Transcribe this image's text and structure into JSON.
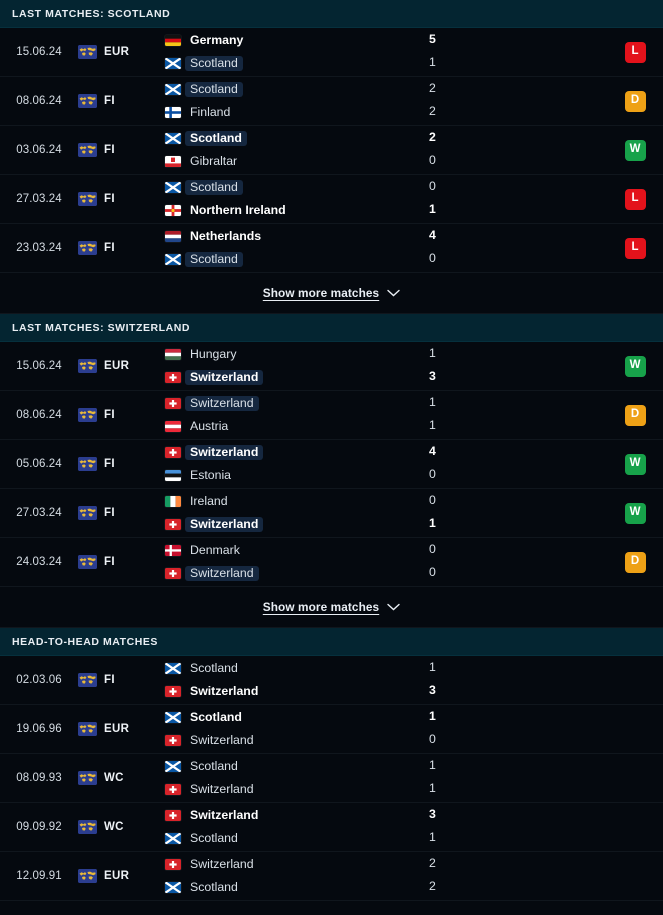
{
  "colors": {
    "background": "#05090f",
    "section_header_bg": "#042531",
    "highlight": "#15273f",
    "win_badge": "#17a24a",
    "draw_badge": "#eea116",
    "loss_badge": "#e3121b"
  },
  "sections": [
    {
      "id": "last-matches-scotland",
      "title": "LAST MATCHES: SCOTLAND",
      "show_more": {
        "label": "Show more matches",
        "icon": "chevron-down-icon"
      },
      "rows": [
        {
          "date": "15.06.24",
          "competition": "EUR",
          "competition_icon": "world-map-icon",
          "home": {
            "team": "Germany",
            "flag": "germany",
            "score": "5",
            "winner": true,
            "highlight": false
          },
          "away": {
            "team": "Scotland",
            "flag": "scotland",
            "score": "1",
            "winner": false,
            "highlight": true
          },
          "result": "L"
        },
        {
          "date": "08.06.24",
          "competition": "FI",
          "competition_icon": "world-map-icon",
          "home": {
            "team": "Scotland",
            "flag": "scotland",
            "score": "2",
            "winner": false,
            "highlight": true
          },
          "away": {
            "team": "Finland",
            "flag": "finland",
            "score": "2",
            "winner": false,
            "highlight": false
          },
          "result": "D"
        },
        {
          "date": "03.06.24",
          "competition": "FI",
          "competition_icon": "world-map-icon",
          "home": {
            "team": "Scotland",
            "flag": "scotland",
            "score": "2",
            "winner": true,
            "highlight": true
          },
          "away": {
            "team": "Gibraltar",
            "flag": "gibraltar",
            "score": "0",
            "winner": false,
            "highlight": false
          },
          "result": "W"
        },
        {
          "date": "27.03.24",
          "competition": "FI",
          "competition_icon": "world-map-icon",
          "home": {
            "team": "Scotland",
            "flag": "scotland",
            "score": "0",
            "winner": false,
            "highlight": true
          },
          "away": {
            "team": "Northern Ireland",
            "flag": "northern-ireland",
            "score": "1",
            "winner": true,
            "highlight": false
          },
          "result": "L"
        },
        {
          "date": "23.03.24",
          "competition": "FI",
          "competition_icon": "world-map-icon",
          "home": {
            "team": "Netherlands",
            "flag": "netherlands",
            "score": "4",
            "winner": true,
            "highlight": false
          },
          "away": {
            "team": "Scotland",
            "flag": "scotland",
            "score": "0",
            "winner": false,
            "highlight": true
          },
          "result": "L"
        }
      ]
    },
    {
      "id": "last-matches-switzerland",
      "title": "LAST MATCHES: SWITZERLAND",
      "show_more": {
        "label": "Show more matches",
        "icon": "chevron-down-icon"
      },
      "rows": [
        {
          "date": "15.06.24",
          "competition": "EUR",
          "competition_icon": "world-map-icon",
          "home": {
            "team": "Hungary",
            "flag": "hungary",
            "score": "1",
            "winner": false,
            "highlight": false
          },
          "away": {
            "team": "Switzerland",
            "flag": "switzerland",
            "score": "3",
            "winner": true,
            "highlight": true
          },
          "result": "W"
        },
        {
          "date": "08.06.24",
          "competition": "FI",
          "competition_icon": "world-map-icon",
          "home": {
            "team": "Switzerland",
            "flag": "switzerland",
            "score": "1",
            "winner": false,
            "highlight": true
          },
          "away": {
            "team": "Austria",
            "flag": "austria",
            "score": "1",
            "winner": false,
            "highlight": false
          },
          "result": "D"
        },
        {
          "date": "05.06.24",
          "competition": "FI",
          "competition_icon": "world-map-icon",
          "home": {
            "team": "Switzerland",
            "flag": "switzerland",
            "score": "4",
            "winner": true,
            "highlight": true
          },
          "away": {
            "team": "Estonia",
            "flag": "estonia",
            "score": "0",
            "winner": false,
            "highlight": false
          },
          "result": "W"
        },
        {
          "date": "27.03.24",
          "competition": "FI",
          "competition_icon": "world-map-icon",
          "home": {
            "team": "Ireland",
            "flag": "ireland",
            "score": "0",
            "winner": false,
            "highlight": false
          },
          "away": {
            "team": "Switzerland",
            "flag": "switzerland",
            "score": "1",
            "winner": true,
            "highlight": true
          },
          "result": "W"
        },
        {
          "date": "24.03.24",
          "competition": "FI",
          "competition_icon": "world-map-icon",
          "home": {
            "team": "Denmark",
            "flag": "denmark",
            "score": "0",
            "winner": false,
            "highlight": false
          },
          "away": {
            "team": "Switzerland",
            "flag": "switzerland",
            "score": "0",
            "winner": false,
            "highlight": true
          },
          "result": "D"
        }
      ]
    },
    {
      "id": "head-to-head-matches",
      "title": "HEAD-TO-HEAD MATCHES",
      "show_more": null,
      "rows": [
        {
          "date": "02.03.06",
          "competition": "FI",
          "competition_icon": "world-map-icon",
          "home": {
            "team": "Scotland",
            "flag": "scotland",
            "score": "1",
            "winner": false,
            "highlight": false
          },
          "away": {
            "team": "Switzerland",
            "flag": "switzerland",
            "score": "3",
            "winner": true,
            "highlight": false
          },
          "result": null
        },
        {
          "date": "19.06.96",
          "competition": "EUR",
          "competition_icon": "world-map-icon",
          "home": {
            "team": "Scotland",
            "flag": "scotland",
            "score": "1",
            "winner": true,
            "highlight": false
          },
          "away": {
            "team": "Switzerland",
            "flag": "switzerland",
            "score": "0",
            "winner": false,
            "highlight": false
          },
          "result": null
        },
        {
          "date": "08.09.93",
          "competition": "WC",
          "competition_icon": "world-map-icon",
          "home": {
            "team": "Scotland",
            "flag": "scotland",
            "score": "1",
            "winner": false,
            "highlight": false
          },
          "away": {
            "team": "Switzerland",
            "flag": "switzerland",
            "score": "1",
            "winner": false,
            "highlight": false
          },
          "result": null
        },
        {
          "date": "09.09.92",
          "competition": "WC",
          "competition_icon": "world-map-icon",
          "home": {
            "team": "Switzerland",
            "flag": "switzerland",
            "score": "3",
            "winner": true,
            "highlight": false
          },
          "away": {
            "team": "Scotland",
            "flag": "scotland",
            "score": "1",
            "winner": false,
            "highlight": false
          },
          "result": null
        },
        {
          "date": "12.09.91",
          "competition": "EUR",
          "competition_icon": "world-map-icon",
          "home": {
            "team": "Switzerland",
            "flag": "switzerland",
            "score": "2",
            "winner": false,
            "highlight": false
          },
          "away": {
            "team": "Scotland",
            "flag": "scotland",
            "score": "2",
            "winner": false,
            "highlight": false
          },
          "result": null
        }
      ]
    }
  ]
}
